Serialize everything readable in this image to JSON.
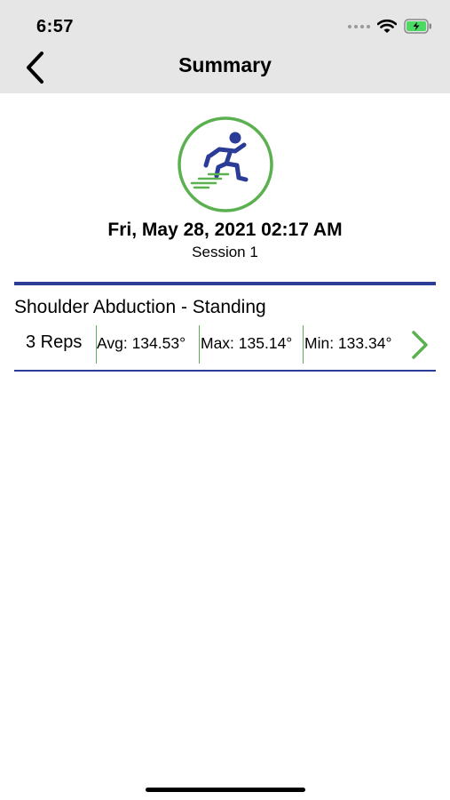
{
  "status_bar": {
    "time": "6:57"
  },
  "nav": {
    "title": "Summary"
  },
  "session": {
    "date": "Fri, May 28, 2021 02:17 AM",
    "label": "Session 1"
  },
  "exercise": {
    "name": "Shoulder Abduction - Standing",
    "reps": "3 Reps",
    "avg": "Avg: 134.53°",
    "max": "Max: 135.14°",
    "min": "Min: 133.34°"
  },
  "colors": {
    "accent_blue": "#2b3c97",
    "accent_green": "#5bb04f",
    "battery_green": "#4cd964"
  },
  "icons": [
    "chevron-left-icon",
    "wifi-icon",
    "battery-icon",
    "running-person-icon",
    "chevron-right-icon"
  ]
}
